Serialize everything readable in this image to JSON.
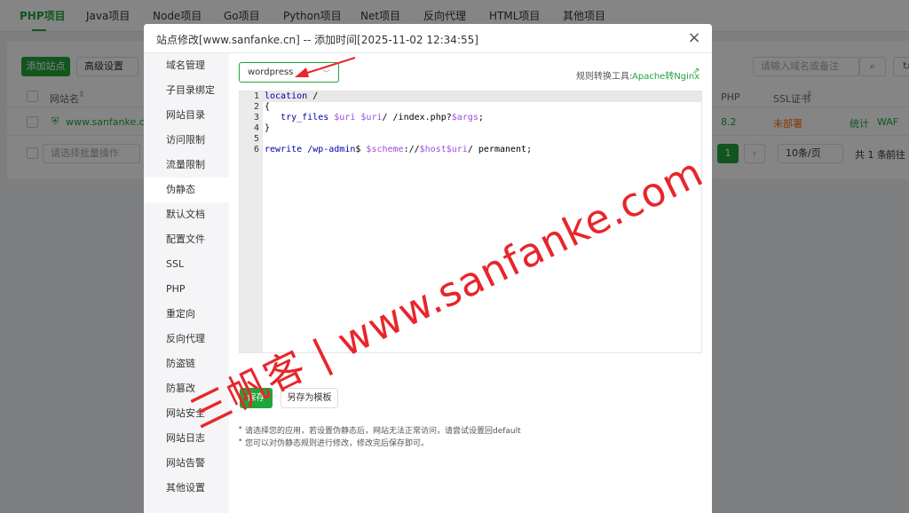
{
  "top_tabs": [
    "PHP项目",
    "Java项目",
    "Node项目",
    "Go项目",
    "Python项目",
    "Net项目",
    "反向代理",
    "HTML项目",
    "其他项目"
  ],
  "background": {
    "add_site_button": "添加站点",
    "advanced_settings": "高级设置",
    "search_placeholder": "请输入域名或备注",
    "col_site_name": "网站名",
    "col_php": "PHP",
    "col_ssl": "SSL证书",
    "site_domain": "www.sanfanke.cn",
    "site_php": "8.2",
    "site_ssl": "未部署",
    "action_stats": "统计",
    "action_waf": "WAF",
    "batch_placeholder": "请选择批量操作",
    "page_current": "1",
    "page_next": "›",
    "page_size": "10条/页",
    "total_text": "共 1 条",
    "goto_text": "前往"
  },
  "modal": {
    "title": "站点修改[www.sanfanke.cn] -- 添加时间[2025-11-02 12:34:55]",
    "close_label": "×",
    "sidebar": [
      {
        "label": "域名管理"
      },
      {
        "label": "子目录绑定"
      },
      {
        "label": "网站目录"
      },
      {
        "label": "访问限制"
      },
      {
        "label": "流量限制"
      },
      {
        "label": "伪静态"
      },
      {
        "label": "默认文档"
      },
      {
        "label": "配置文件"
      },
      {
        "label": "SSL"
      },
      {
        "label": "PHP"
      },
      {
        "label": "重定向"
      },
      {
        "label": "反向代理"
      },
      {
        "label": "防盗链"
      },
      {
        "label": "防篡改"
      },
      {
        "label": "网站安全"
      },
      {
        "label": "网站日志"
      },
      {
        "label": "网站告警"
      },
      {
        "label": "其他设置"
      }
    ],
    "active_sidebar": "伪静态",
    "template_select": {
      "value": "wordpress"
    },
    "tool_label": "规则转换工具:",
    "tool_link": "Apache转Nginx",
    "editor": {
      "line_numbers": [
        "1",
        "2",
        "3",
        "4",
        "5",
        "6"
      ],
      "lines": [
        "location /",
        "{",
        "   try_files $uri $uri/ /index.php?$args;",
        "}",
        "",
        "rewrite /wp-admin$ $scheme://$host$uri/ permanent;"
      ]
    },
    "save_button": "保存",
    "save_template_button": "另存为模板",
    "tips": [
      "请选择您的应用，若设置伪静态后，网站无法正常访问，请尝试设置回default",
      "您可以对伪静态规则进行修改，修改完后保存即可。"
    ]
  },
  "watermark": "三帆客 | www.sanfanke.com",
  "colors": {
    "accent": "#20a53a",
    "watermark": "#e8262b",
    "warning": "#ff6a00"
  }
}
